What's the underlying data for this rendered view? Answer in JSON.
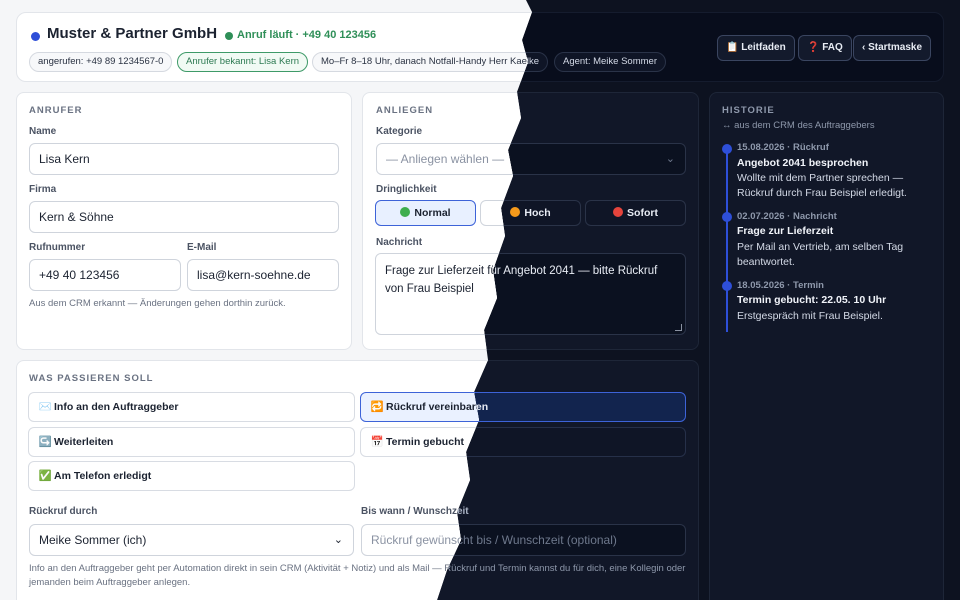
{
  "header": {
    "company": "Muster & Partner GmbH",
    "call_status": "Anruf läuft · +49 40 123456",
    "chips": [
      "angerufen: +49 89 1234567-0",
      "Anrufer bekannt: Lisa Kern",
      "Mo–Fr 8–18 Uhr, danach Notfall-Handy Herr Kaelke",
      "Agent: Meike Sommer"
    ],
    "buttons": {
      "guide": "📋 Leitfaden",
      "faq": "❓ FAQ",
      "home": "‹ Startmaske"
    }
  },
  "caller": {
    "section": "ANRUFER",
    "name_label": "Name",
    "name_value": "Lisa Kern",
    "company_label": "Firma",
    "company_value": "Kern & Söhne",
    "phone_label": "Rufnummer",
    "phone_value": "+49 40 123456",
    "email_label": "E-Mail",
    "email_value": "lisa@kern-soehne.de",
    "hint": "Aus dem CRM erkannt — Änderungen gehen dorthin zurück."
  },
  "concern": {
    "section": "ANLIEGEN",
    "category_label": "Kategorie",
    "category_placeholder": "— Anliegen wählen —",
    "urgency_label": "Dringlichkeit",
    "urgency": [
      "Normal",
      "Hoch",
      "Sofort"
    ],
    "urgency_selected": "Normal",
    "message_label": "Nachricht",
    "message_value": "Frage zur Lieferzeit für Angebot 2041 — bitte Rückruf von Frau Beispiel"
  },
  "actions": {
    "section": "WAS PASSIEREN SOLL",
    "items": [
      {
        "icon": "✉️",
        "label": "Info an den Auftraggeber"
      },
      {
        "icon": "🔁",
        "label": "Rückruf vereinbaren"
      },
      {
        "icon": "↪️",
        "label": "Weiterleiten"
      },
      {
        "icon": "📅",
        "label": "Termin gebucht"
      },
      {
        "icon": "✅",
        "label": "Am Telefon erledigt"
      }
    ],
    "selected": "Rückruf vereinbaren",
    "callback_by_label": "Rückruf durch",
    "callback_by_value": "Meike Sommer (ich)",
    "until_label": "Bis wann / Wunschzeit",
    "until_placeholder": "Rückruf gewünscht bis / Wunschzeit (optional)",
    "hint": "Info an den Auftraggeber geht per Automation direkt in sein CRM (Aktivität + Notiz) und als Mail — Rückruf und Termin kannst du für dich, eine Kollegin oder jemanden beim Auftraggeber anlegen."
  },
  "history": {
    "section": "HISTORIE",
    "subtitle": "↔ aus dem CRM des Auftraggebers",
    "entries": [
      {
        "meta": "15.08.2026 · Rückruf",
        "title": "Angebot 2041 besprochen",
        "text": "Wollte mit dem Partner sprechen — Rückruf durch Frau Beispiel erledigt."
      },
      {
        "meta": "02.07.2026 · Nachricht",
        "title": "Frage zur Lieferzeit",
        "text": "Per Mail an Vertrieb, am selben Tag beantwortet."
      },
      {
        "meta": "18.05.2026 · Termin",
        "title": "Termin gebucht: 22.05. 10 Uhr",
        "text": "Erstgespräch mit Frau Beispiel."
      }
    ]
  },
  "colors": {
    "accent": "#2e4fd8",
    "call_green": "#2f8f58",
    "urgency_normal": "#3fae4e",
    "urgency_high": "#f59a1b",
    "urgency_now": "#e5443c"
  }
}
